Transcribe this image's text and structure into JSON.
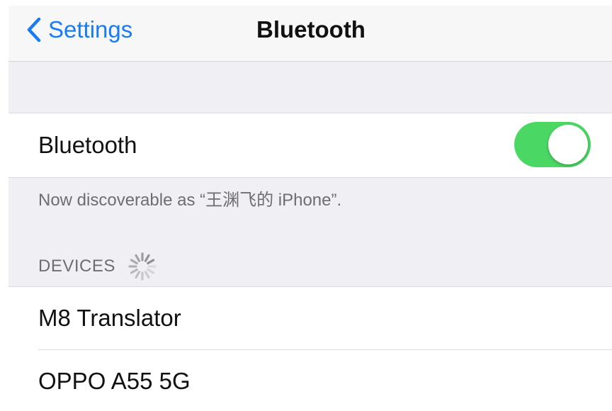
{
  "navbar": {
    "back_label": "Settings",
    "title": "Bluetooth"
  },
  "bluetooth_toggle": {
    "label": "Bluetooth",
    "state": "on",
    "on_color": "#4bd764"
  },
  "discoverable_note": "Now discoverable as “王渊飞的 iPhone”.",
  "devices": {
    "header": "DEVICES",
    "loading_icon": "spinner-icon",
    "items": [
      {
        "name": "M8 Translator"
      },
      {
        "name": "OPPO A55 5G"
      }
    ]
  },
  "colors": {
    "accent": "#1a7cf4",
    "background": "#efeff4",
    "secondary_text": "#6d6d72"
  }
}
